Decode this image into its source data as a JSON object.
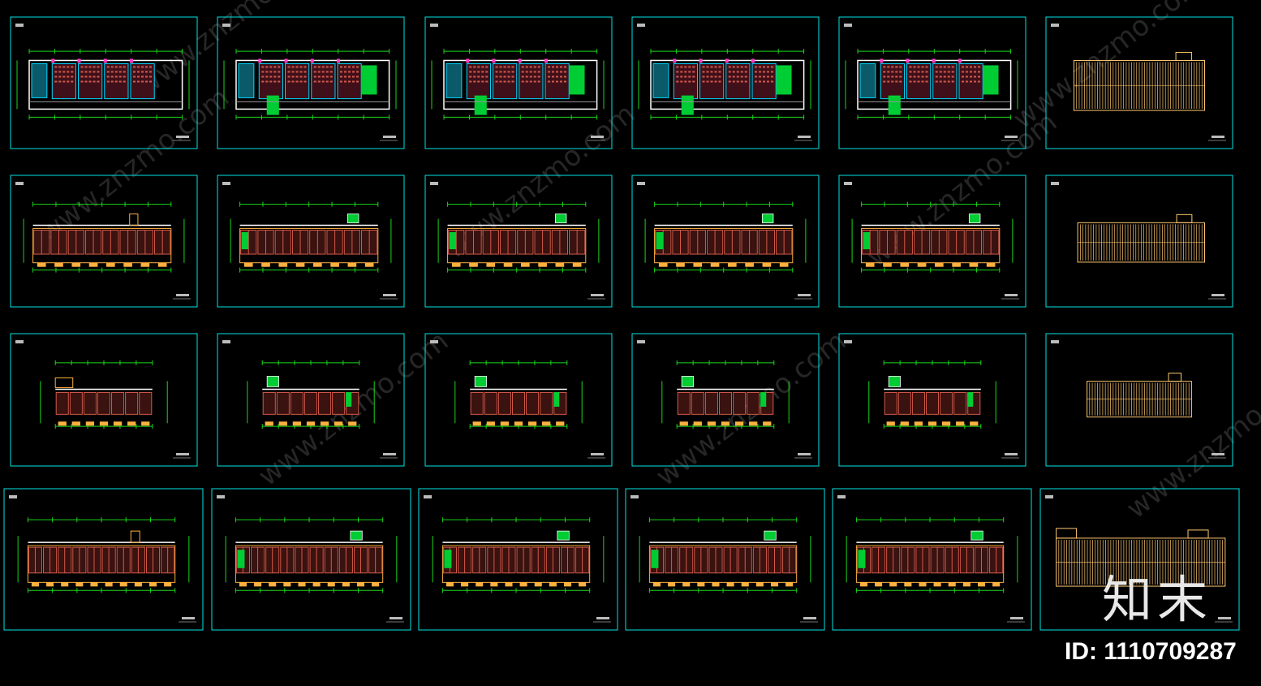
{
  "watermark": {
    "logo": "知末",
    "id_text": "ID: 1110709287",
    "site": "www.znzmo.com"
  },
  "colors": {
    "background": "#000000",
    "sheet_border": "#00e5e5",
    "wall": "#ffffff",
    "room_fill": "#d35a4a",
    "room_line": "#ffb040",
    "stair": "#00cc33",
    "dimension": "#1ad61a",
    "elevation": "#ffc870",
    "pink": "#ff3cc8",
    "cyan": "#00d8ff"
  },
  "sheet_rows": [
    {
      "row_type": "plan-type-a",
      "sheets": 6,
      "last_is_elevation": true
    },
    {
      "row_type": "plan-type-b",
      "sheets": 6,
      "last_is_elevation": true
    },
    {
      "row_type": "plan-type-c",
      "sheets": 6,
      "last_is_elevation": true
    },
    {
      "row_type": "plan-type-d",
      "sheets": 6,
      "last_is_elevation": true
    }
  ]
}
